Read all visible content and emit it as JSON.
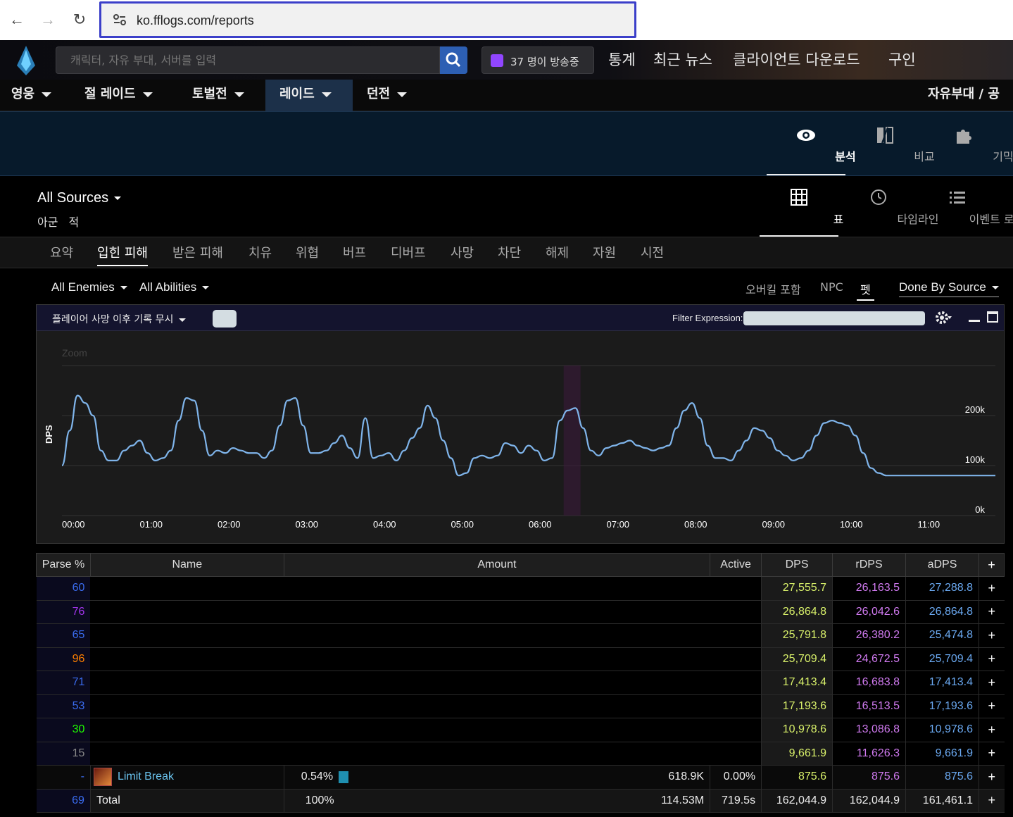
{
  "browser": {
    "url": "ko.fflogs.com/reports"
  },
  "header": {
    "search_placeholder": "캐릭터, 자유 부대, 서버를 입력",
    "twitch_text": "37 명이 방송중",
    "nav": [
      "통계",
      "최근 뉴스",
      "클라이언트 다운로드",
      "구인"
    ]
  },
  "menu": {
    "items": [
      {
        "label": "영웅",
        "active": false
      },
      {
        "label": "절 레이드",
        "active": false
      },
      {
        "label": "토벌전",
        "active": false
      },
      {
        "label": "레이드",
        "active": true
      },
      {
        "label": "던전",
        "active": false
      }
    ],
    "right_label": "자유부대 / 공"
  },
  "tools": [
    {
      "label": "분석",
      "icon": "eye-icon",
      "active": true
    },
    {
      "label": "비교",
      "icon": "compare-icon",
      "active": false
    },
    {
      "label": "기믹",
      "icon": "puzzle-icon",
      "active": false
    }
  ],
  "sources": {
    "title": "All Sources",
    "sub": "아군 적"
  },
  "views": [
    {
      "label": "표",
      "icon": "grid-icon",
      "active": true
    },
    {
      "label": "타임라인",
      "icon": "clock-icon",
      "active": false
    },
    {
      "label": "이벤트 로그",
      "icon": "list-icon",
      "active": false
    }
  ],
  "sub_tabs": [
    "요약",
    "입힌 피해",
    "받은 피해",
    "치유",
    "위협",
    "버프",
    "디버프",
    "사망",
    "차단",
    "해제",
    "자원",
    "시전"
  ],
  "sub_tab_active": 1,
  "filters": {
    "enemies": "All Enemies",
    "abilities": "All Abilities",
    "overkill": "오버킬 포함",
    "npc": "NPC",
    "pet": "펫",
    "done_by": "Done By Source"
  },
  "graph": {
    "ignore_label": "플레이어 사망 이후 기록 무시",
    "filter_label": "Filter Expression:",
    "zoom_label": "Zoom"
  },
  "chart_data": {
    "type": "line",
    "ylabel": "DPS",
    "ylim": [
      0,
      300000
    ],
    "y_ticks": [
      "0k",
      "100k",
      "200k"
    ],
    "x_ticks": [
      "00:00",
      "01:00",
      "02:00",
      "03:00",
      "04:00",
      "05:00",
      "06:00",
      "07:00",
      "08:00",
      "09:00",
      "10:00",
      "11:00"
    ],
    "series": [
      {
        "color": "#7fb4ea",
        "x": [
          0,
          6,
          12,
          18,
          24,
          30,
          36,
          42,
          48,
          54,
          60,
          66,
          72,
          78,
          84,
          90,
          96,
          102,
          108,
          114,
          120,
          126,
          132,
          138,
          144,
          150,
          156,
          162,
          168,
          174,
          180,
          186,
          192,
          198,
          204,
          210,
          216,
          222,
          228,
          234,
          240,
          246,
          252,
          258,
          264,
          270,
          276,
          282,
          288,
          294,
          300,
          306,
          312,
          318,
          324,
          330,
          336,
          342,
          348,
          354,
          360,
          366,
          372,
          378,
          384,
          390,
          396,
          402,
          408,
          414,
          420,
          426,
          432,
          438,
          444,
          450,
          456,
          462,
          468,
          474,
          480,
          486,
          492,
          498,
          504,
          510,
          516,
          522,
          528,
          534,
          540,
          546,
          552,
          558,
          564,
          570,
          576,
          582,
          588,
          594,
          600,
          606,
          612,
          618,
          624,
          630,
          636,
          642,
          648,
          654,
          660,
          666,
          672,
          678,
          684,
          690,
          696,
          702,
          708,
          714,
          720
        ],
        "y": [
          100000,
          170000,
          240000,
          225000,
          200000,
          130000,
          110000,
          110000,
          130000,
          140000,
          150000,
          125000,
          110000,
          115000,
          130000,
          190000,
          235000,
          230000,
          170000,
          120000,
          130000,
          125000,
          135000,
          130000,
          125000,
          125000,
          115000,
          130000,
          180000,
          230000,
          235000,
          180000,
          125000,
          125000,
          130000,
          145000,
          160000,
          135000,
          115000,
          195000,
          115000,
          120000,
          125000,
          110000,
          130000,
          155000,
          175000,
          220000,
          195000,
          150000,
          115000,
          80000,
          85000,
          115000,
          120000,
          115000,
          120000,
          145000,
          140000,
          125000,
          140000,
          130000,
          110000,
          115000,
          190000,
          210000,
          215000,
          175000,
          130000,
          120000,
          135000,
          140000,
          145000,
          150000,
          140000,
          135000,
          130000,
          135000,
          140000,
          175000,
          210000,
          225000,
          195000,
          140000,
          115000,
          115000,
          110000,
          130000,
          150000,
          175000,
          170000,
          155000,
          130000,
          120000,
          110000,
          115000,
          130000,
          160000,
          185000,
          190000,
          185000,
          180000,
          160000,
          125000,
          95000,
          85000,
          80000,
          80000,
          80000,
          80000,
          80000,
          80000,
          80000,
          80000,
          80000,
          80000,
          80000,
          80000,
          80000,
          80000,
          80000
        ]
      }
    ],
    "highlight_range": [
      "06:27",
      "06:40"
    ]
  },
  "table": {
    "headers": [
      "Parse %",
      "Name",
      "Amount",
      "Active",
      "DPS",
      "rDPS",
      "aDPS",
      "+"
    ],
    "rows": [
      {
        "parse": "60",
        "parse_color": "#3a6cf0",
        "dps": "27,555.7",
        "rdps": "26,163.5",
        "adps": "27,288.8"
      },
      {
        "parse": "76",
        "parse_color": "#a335ee",
        "dps": "26,864.8",
        "rdps": "26,042.6",
        "adps": "26,864.8"
      },
      {
        "parse": "65",
        "parse_color": "#3a6cf0",
        "dps": "25,791.8",
        "rdps": "26,380.2",
        "adps": "25,474.8"
      },
      {
        "parse": "96",
        "parse_color": "#ff8000",
        "dps": "25,709.4",
        "rdps": "24,672.5",
        "adps": "25,709.4"
      },
      {
        "parse": "71",
        "parse_color": "#3a6cf0",
        "dps": "17,413.4",
        "rdps": "16,683.8",
        "adps": "17,413.4"
      },
      {
        "parse": "53",
        "parse_color": "#3a6cf0",
        "dps": "17,193.6",
        "rdps": "16,513.5",
        "adps": "17,193.6"
      },
      {
        "parse": "30",
        "parse_color": "#1eff00",
        "dps": "10,978.6",
        "rdps": "13,086.8",
        "adps": "10,978.6"
      },
      {
        "parse": "15",
        "parse_color": "#888888",
        "dps": "9,661.9",
        "rdps": "11,626.3",
        "adps": "9,661.9"
      }
    ],
    "limit_break": {
      "parse": "-",
      "name": "Limit Break",
      "pct": "0.54%",
      "amount": "618.9K",
      "active": "0.00%",
      "dps": "875.6",
      "rdps": "875.6",
      "adps": "875.6"
    },
    "total": {
      "parse": "69",
      "name": "Total",
      "pct": "100%",
      "amount": "114.53M",
      "active": "719.5s",
      "dps": "162,044.9",
      "rdps": "162,044.9",
      "adps": "161,461.1"
    }
  }
}
